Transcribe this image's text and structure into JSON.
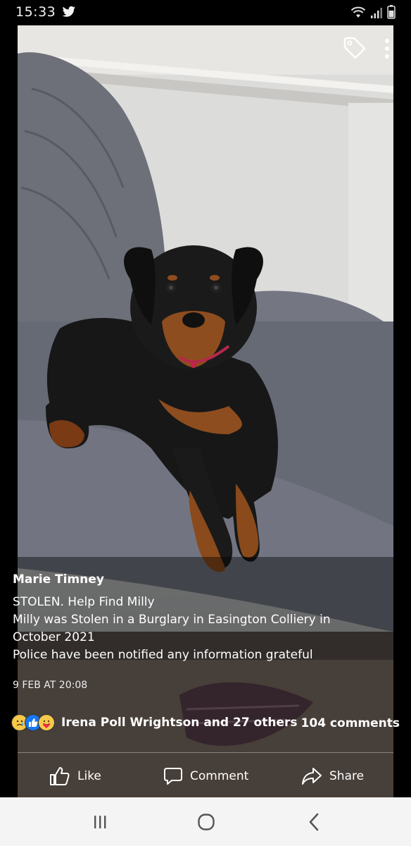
{
  "status_bar": {
    "time": "15:33",
    "icons": [
      "twitter-icon",
      "wifi-icon",
      "signal-icon",
      "battery-icon"
    ]
  },
  "photo": {
    "top_icons": [
      "tag-icon",
      "more-vert-icon"
    ]
  },
  "post": {
    "author": "Marie Timney",
    "text_lines": [
      "STOLEN. Help Find Milly",
      "Milly was Stolen in a Burglary in Easington Colliery in",
      "October 2021",
      "Police have been notified any information grateful"
    ],
    "timestamp": "9 FEB AT 20:08",
    "reactions": [
      "sad-emoji",
      "like-emoji",
      "care-emoji"
    ],
    "reactors_text": "Irena Poll Wrightson and 27 others",
    "comment_count": "104 comments"
  },
  "actions": {
    "like": "Like",
    "comment": "Comment",
    "share": "Share"
  },
  "nav": {
    "buttons": [
      "recents-icon",
      "home-icon",
      "back-icon"
    ]
  },
  "colors": {
    "like_blue": "#1877f2",
    "overlay": "#000000",
    "nav_bg": "#f4f4f4"
  }
}
